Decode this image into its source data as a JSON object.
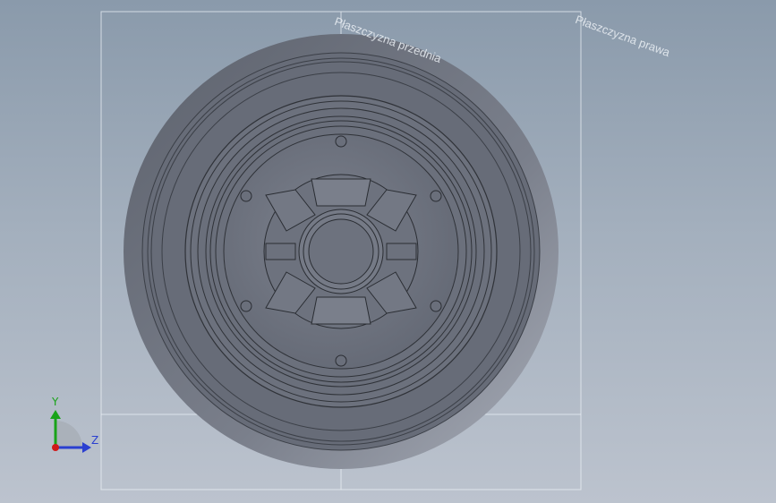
{
  "planes": {
    "front_label": "Płaszczyzna przednia",
    "right_label": "Płaszczyzna prawa"
  },
  "triad": {
    "y_label": "Y",
    "z_label": "Z"
  },
  "colors": {
    "background_top": "#8a9aab",
    "background_bottom": "#bcc3ce",
    "part_shade": "#6f7480",
    "axis_y": "#19a319",
    "axis_z": "#2a3fd0",
    "axis_x": "#d01919"
  }
}
